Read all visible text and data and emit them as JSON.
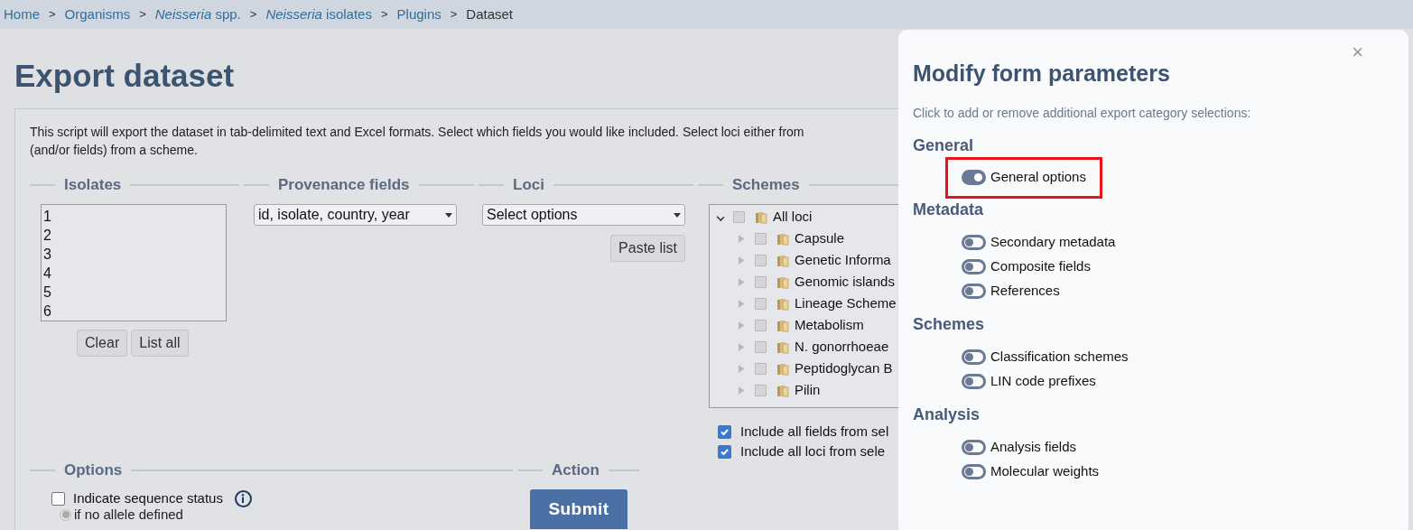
{
  "breadcrumb": [
    {
      "label": "Home",
      "link": true
    },
    {
      "separator": ">",
      "label": "Organisms",
      "link": true
    },
    {
      "separator": ">",
      "label": "*Neisseria* spp.",
      "link": true
    },
    {
      "separator": ">",
      "label": "*Neisseria* isolates",
      "link": true
    },
    {
      "separator": ">",
      "label": "Plugins",
      "link": true
    },
    {
      "separator": ">",
      "label": "Dataset",
      "link": false
    }
  ],
  "page_title": "Export dataset",
  "intro_lines": [
    "This script will export the dataset in tab-delimited text and Excel formats. Select which fields you would like included. Select loci either from",
    "(and/or fields) from a scheme."
  ],
  "isolates": {
    "legend": "Isolates",
    "values": [
      "1",
      "2",
      "3",
      "4",
      "5",
      "6"
    ],
    "buttons": [
      "Clear",
      "List all"
    ]
  },
  "provenance": {
    "legend": "Provenance fields",
    "value": "id, isolate, country, year"
  },
  "loci": {
    "legend": "Loci",
    "value": "Select options",
    "button": "Paste list"
  },
  "schemes": {
    "legend": "Schemes",
    "tree": [
      {
        "label": "All loci",
        "checked": false,
        "expanded": true,
        "children": [
          {
            "label": "Capsule",
            "checked": false,
            "expanded": false
          },
          {
            "label": "Genetic Informa",
            "checked": false,
            "expanded": false
          },
          {
            "label": "Genomic islands",
            "checked": false,
            "expanded": false
          },
          {
            "label": "Lineage Scheme",
            "checked": false,
            "expanded": false
          },
          {
            "label": "Metabolism",
            "checked": false,
            "expanded": false
          },
          {
            "label": "N. gonorrhoeae",
            "checked": false,
            "expanded": false
          },
          {
            "label": "Peptidoglycan B",
            "checked": false,
            "expanded": false
          },
          {
            "label": "Pilin",
            "checked": false,
            "expanded": false
          }
        ]
      }
    ],
    "options": [
      {
        "label": "Include all fields from sel",
        "checked": true
      },
      {
        "label": "Include all loci from sele",
        "checked": true
      }
    ]
  },
  "options": {
    "legend": "Options",
    "items": [
      {
        "kind": "checkbox",
        "label": "Indicate sequence status",
        "checked": false,
        "info": true
      },
      {
        "kind": "radio",
        "label": "if no allele defined",
        "selected": true,
        "disabled": true
      }
    ]
  },
  "action": {
    "legend": "Action",
    "button": "Submit"
  },
  "modal": {
    "title": "Modify form parameters",
    "subtitle": "Click to add or remove additional export category selections:",
    "close": "×",
    "sections": [
      {
        "heading": "General",
        "items": [
          {
            "label": "General options",
            "on": true,
            "highlighted": true
          }
        ]
      },
      {
        "heading": "Metadata",
        "items": [
          {
            "label": "Secondary metadata",
            "on": false,
            "highlighted": false
          },
          {
            "label": "Composite fields",
            "on": false,
            "highlighted": false
          },
          {
            "label": "References",
            "on": false,
            "highlighted": false
          }
        ]
      },
      {
        "heading": "Schemes",
        "items": [
          {
            "label": "Classification schemes",
            "on": false,
            "highlighted": false
          },
          {
            "label": "LIN code prefixes",
            "on": false,
            "highlighted": false
          }
        ]
      },
      {
        "heading": "Analysis",
        "items": [
          {
            "label": "Analysis fields",
            "on": false,
            "highlighted": false
          },
          {
            "label": "Molecular weights",
            "on": false,
            "highlighted": false
          }
        ]
      }
    ]
  }
}
